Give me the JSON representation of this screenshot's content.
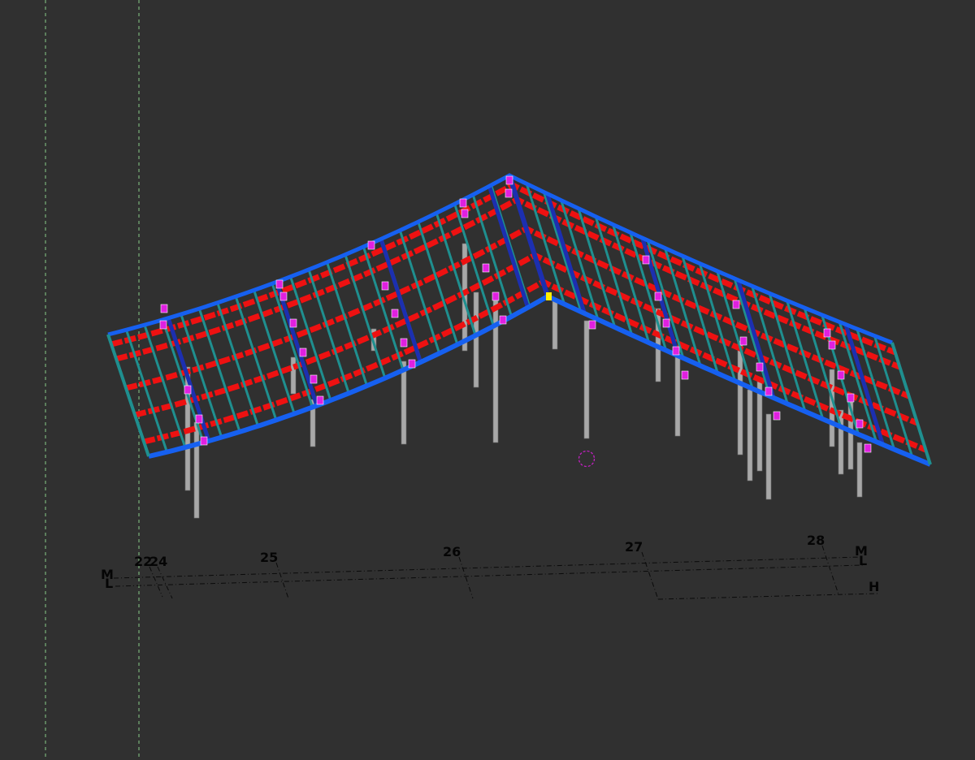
{
  "viewport": {
    "background": "#303030",
    "view": "3D perspective model view"
  },
  "colors": {
    "column": "#a8a8a8",
    "beam_outer": "#1660f0",
    "beam_inner": "#1c2fb0",
    "rafter": "#1f8f8f",
    "purlin": "#ee1111",
    "connection": "#e020e0",
    "selected_node": "#ffee00",
    "guide_line": "#88cc88",
    "gridline": "#0a0a0a",
    "cursor": "#c020c0"
  },
  "grids": {
    "vertical": [
      {
        "label": "22"
      },
      {
        "label": "24"
      },
      {
        "label": "25"
      },
      {
        "label": "26"
      },
      {
        "label": "27"
      },
      {
        "label": "28"
      }
    ],
    "horizontal": [
      {
        "label": "M"
      },
      {
        "label": "L"
      },
      {
        "label": "H"
      }
    ]
  },
  "icons": {
    "cursor": "snap-circle-icon"
  }
}
